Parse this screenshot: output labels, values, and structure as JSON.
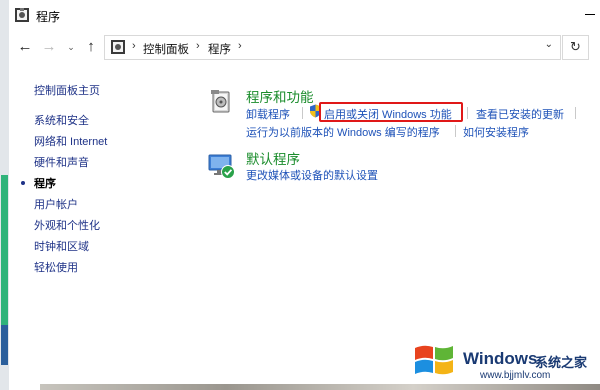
{
  "window": {
    "title": "程序"
  },
  "address_bar": {
    "crumbs": [
      "控制面板",
      "程序"
    ],
    "separator": "›"
  },
  "nav_icons": {
    "back": "←",
    "forward": "→",
    "recent": "⌄",
    "up": "↑",
    "dropdown": "⌄",
    "refresh": "↻"
  },
  "sidebar": {
    "home": "控制面板主页",
    "items": [
      {
        "label": "系统和安全",
        "current": false
      },
      {
        "label": "网络和 Internet",
        "current": false
      },
      {
        "label": "硬件和声音",
        "current": false
      },
      {
        "label": "程序",
        "current": true
      },
      {
        "label": "用户帐户",
        "current": false
      },
      {
        "label": "外观和个性化",
        "current": false
      },
      {
        "label": "时钟和区域",
        "current": false
      },
      {
        "label": "轻松使用",
        "current": false
      }
    ]
  },
  "categories": {
    "programs": {
      "title": "程序和功能",
      "links": {
        "uninstall": "卸载程序",
        "features": "启用或关闭 Windows 功能",
        "updates": "查看已安装的更新",
        "compat": "运行为以前版本的 Windows 编写的程序",
        "howto": "如何安装程序"
      }
    },
    "defaults": {
      "title": "默认程序",
      "links": {
        "media": "更改媒体或设备的默认设置"
      }
    }
  },
  "colors": {
    "category_title": "#1a8c2b",
    "link": "#1e52b8",
    "sidebar_link": "#1e3287",
    "highlight_box": "#e01818"
  },
  "watermark": {
    "brand": "Windows",
    "site": "系统之家",
    "url": "www.bjjmlv.com"
  }
}
